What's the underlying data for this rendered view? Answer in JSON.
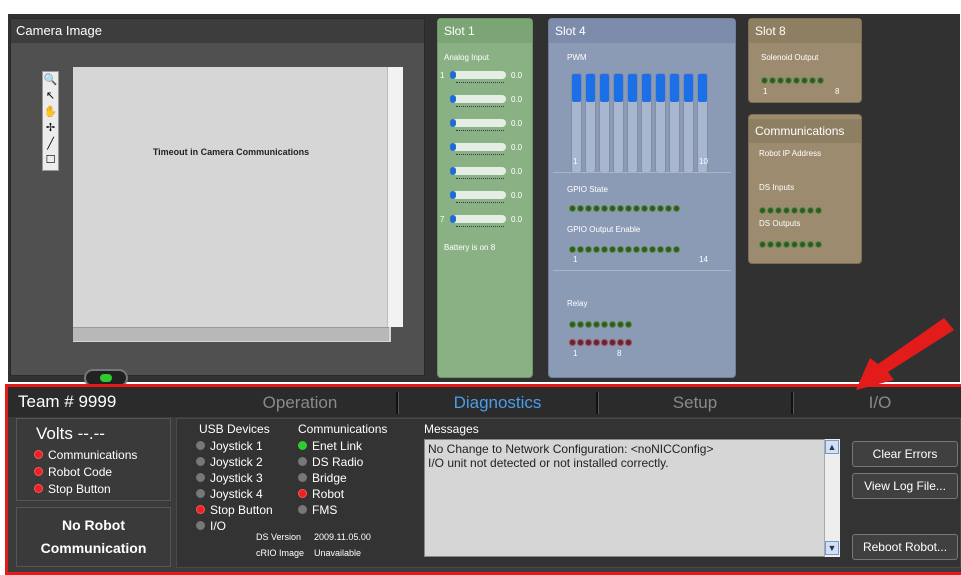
{
  "camera": {
    "title": "Camera Image",
    "message": "Timeout in Camera Communications",
    "tools": [
      "🔍",
      "↖",
      "✋",
      "✢",
      "╱",
      "☐"
    ]
  },
  "slot1": {
    "title": "Slot 1",
    "subtitle": "Analog Input",
    "channels": [
      {
        "num": "1",
        "value": "0.0"
      },
      {
        "num": "",
        "value": "0.0"
      },
      {
        "num": "",
        "value": "0.0"
      },
      {
        "num": "",
        "value": "0.0"
      },
      {
        "num": "",
        "value": "0.0"
      },
      {
        "num": "",
        "value": "0.0"
      },
      {
        "num": "7",
        "value": "0.0"
      }
    ],
    "battery": "Battery is on 8"
  },
  "slot4": {
    "title": "Slot 4",
    "pwm_label": "PWM",
    "pwm_min": "1",
    "pwm_max": "10",
    "gpio_state_label": "GPIO State",
    "gpio_output_label": "GPIO Output Enable",
    "gpio_min": "1",
    "gpio_max": "14",
    "relay_label": "Relay",
    "relay_min": "1",
    "relay_max": "8"
  },
  "slot8": {
    "title": "Slot 8",
    "subtitle": "Solenoid Output",
    "min": "1",
    "max": "8"
  },
  "communications_panel": {
    "title": "Communications",
    "ip_label": "Robot IP Address",
    "ds_inputs": "DS Inputs",
    "ds_outputs": "DS Outputs"
  },
  "bottom": {
    "team": "Team # 9999",
    "tabs": [
      "Operation",
      "Diagnostics",
      "Setup",
      "I/O"
    ],
    "active_tab": "Diagnostics",
    "volts": "Volts  --.--",
    "status": [
      "Communications",
      "Robot Code",
      "Stop Button"
    ],
    "no_robot_1": "No Robot",
    "no_robot_2": "Communication"
  },
  "diagnostics": {
    "usb_header": "USB Devices",
    "usb": [
      "Joystick 1",
      "Joystick 2",
      "Joystick 3",
      "Joystick 4",
      "Stop Button",
      "I/O"
    ],
    "comm_header": "Communications",
    "comm": [
      "Enet Link",
      "DS Radio",
      "Bridge",
      "Robot",
      "FMS"
    ],
    "ds_version_label": "DS Version",
    "ds_version": "2009.11.05.00",
    "crio_label": "cRIO Image",
    "crio": "Unavailable",
    "messages_header": "Messages",
    "messages": [
      "No Change to Network Configuration: <noNICConfig>",
      "I/O unit not detected or not installed correctly."
    ],
    "buttons": [
      "Clear Errors",
      "View Log File...",
      "Reboot Robot..."
    ]
  },
  "colors": {
    "accent": "#4a9eea",
    "frame_red": "#e41b1b",
    "led_red": "#ee2020",
    "led_green": "#2ecc2e"
  }
}
